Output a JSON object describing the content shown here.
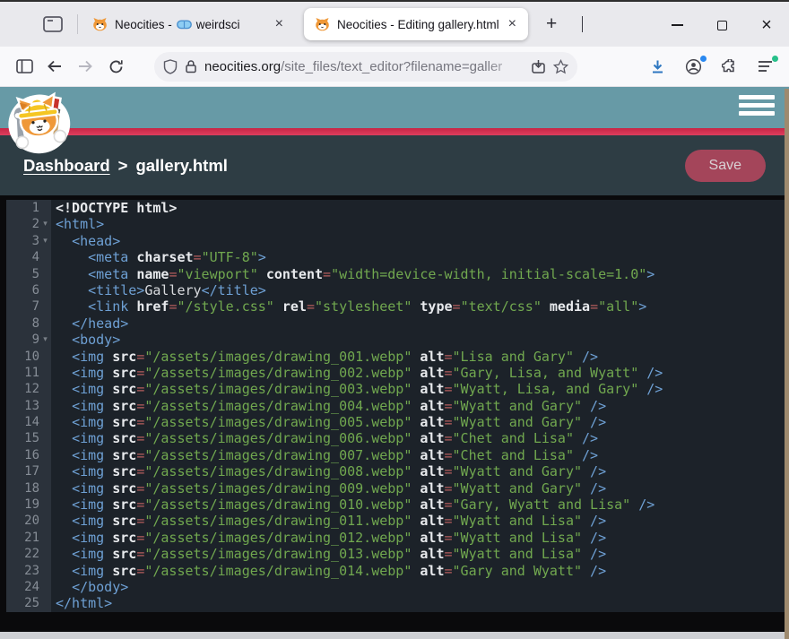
{
  "colors": {
    "header_teal": "#679aa6",
    "stripe_red": "#d22c4f",
    "content_bg": "#2e3d44",
    "save_button": "#a4455a",
    "editor_bg": "#1c2229",
    "gutter_bg": "#2b323b",
    "tag_blue": "#6ea0d4",
    "string_green": "#71a84f",
    "attr_white": "#e8eaed",
    "equals_red": "#b55d5d",
    "download_blue": "#2e77c0",
    "badge_blue": "#2a88f0",
    "badge_green": "#27c08a"
  },
  "tabs": {
    "tab1": {
      "title_prefix": "Neocities -",
      "title_suffix": "weirdsci",
      "close": "×"
    },
    "tab2": {
      "title": "Neocities - Editing gallery.html",
      "close": "×"
    },
    "new_tab": "+"
  },
  "window_controls": {
    "close": "×"
  },
  "toolbar": {
    "url_host": "neocities.org",
    "url_path": "/site_files/text_editor?filename=galler"
  },
  "breadcrumb": {
    "dashboard": "Dashboard",
    "separator": ">",
    "filename": "gallery.html"
  },
  "actions": {
    "save_label": "Save"
  },
  "editor": {
    "lines": [
      {
        "n": "1",
        "fold": false,
        "tokens": [
          [
            "d",
            "<!DOCTYPE html>"
          ]
        ]
      },
      {
        "n": "2",
        "fold": true,
        "tokens": [
          [
            "t",
            "<html>"
          ]
        ]
      },
      {
        "n": "3",
        "fold": true,
        "tokens": [
          [
            "p",
            "  "
          ],
          [
            "t",
            "<head>"
          ]
        ]
      },
      {
        "n": "4",
        "fold": false,
        "tokens": [
          [
            "p",
            "    "
          ],
          [
            "t",
            "<meta"
          ],
          [
            "p",
            " "
          ],
          [
            "a",
            "charset"
          ],
          [
            "e",
            "="
          ],
          [
            "s",
            "\"UTF-8\""
          ],
          [
            "t",
            ">"
          ]
        ]
      },
      {
        "n": "5",
        "fold": false,
        "tokens": [
          [
            "p",
            "    "
          ],
          [
            "t",
            "<meta"
          ],
          [
            "p",
            " "
          ],
          [
            "a",
            "name"
          ],
          [
            "e",
            "="
          ],
          [
            "s",
            "\"viewport\""
          ],
          [
            "p",
            " "
          ],
          [
            "a",
            "content"
          ],
          [
            "e",
            "="
          ],
          [
            "s",
            "\"width=device-width, initial-scale=1.0\""
          ],
          [
            "t",
            ">"
          ]
        ]
      },
      {
        "n": "6",
        "fold": false,
        "tokens": [
          [
            "p",
            "    "
          ],
          [
            "t",
            "<title>"
          ],
          [
            "p",
            "Gallery"
          ],
          [
            "t",
            "</title>"
          ]
        ]
      },
      {
        "n": "7",
        "fold": false,
        "tokens": [
          [
            "p",
            "    "
          ],
          [
            "t",
            "<link"
          ],
          [
            "p",
            " "
          ],
          [
            "a",
            "href"
          ],
          [
            "e",
            "="
          ],
          [
            "s",
            "\"/style.css\""
          ],
          [
            "p",
            " "
          ],
          [
            "a",
            "rel"
          ],
          [
            "e",
            "="
          ],
          [
            "s",
            "\"stylesheet\""
          ],
          [
            "p",
            " "
          ],
          [
            "a",
            "type"
          ],
          [
            "e",
            "="
          ],
          [
            "s",
            "\"text/css\""
          ],
          [
            "p",
            " "
          ],
          [
            "a",
            "media"
          ],
          [
            "e",
            "="
          ],
          [
            "s",
            "\"all\""
          ],
          [
            "t",
            ">"
          ]
        ]
      },
      {
        "n": "8",
        "fold": false,
        "tokens": [
          [
            "p",
            "  "
          ],
          [
            "t",
            "</head>"
          ]
        ]
      },
      {
        "n": "9",
        "fold": true,
        "tokens": [
          [
            "p",
            "  "
          ],
          [
            "t",
            "<body>"
          ]
        ]
      },
      {
        "n": "10",
        "fold": false,
        "tokens": [
          [
            "p",
            "  "
          ],
          [
            "t",
            "<img"
          ],
          [
            "p",
            " "
          ],
          [
            "a",
            "src"
          ],
          [
            "e",
            "="
          ],
          [
            "s",
            "\"/assets/images/drawing_001.webp\""
          ],
          [
            "p",
            " "
          ],
          [
            "a",
            "alt"
          ],
          [
            "e",
            "="
          ],
          [
            "s",
            "\"Lisa and Gary\""
          ],
          [
            "p",
            " "
          ],
          [
            "t",
            "/>"
          ]
        ]
      },
      {
        "n": "11",
        "fold": false,
        "tokens": [
          [
            "p",
            "  "
          ],
          [
            "t",
            "<img"
          ],
          [
            "p",
            " "
          ],
          [
            "a",
            "src"
          ],
          [
            "e",
            "="
          ],
          [
            "s",
            "\"/assets/images/drawing_002.webp\""
          ],
          [
            "p",
            " "
          ],
          [
            "a",
            "alt"
          ],
          [
            "e",
            "="
          ],
          [
            "s",
            "\"Gary, Lisa, and Wyatt\""
          ],
          [
            "p",
            " "
          ],
          [
            "t",
            "/>"
          ]
        ]
      },
      {
        "n": "12",
        "fold": false,
        "tokens": [
          [
            "p",
            "  "
          ],
          [
            "t",
            "<img"
          ],
          [
            "p",
            " "
          ],
          [
            "a",
            "src"
          ],
          [
            "e",
            "="
          ],
          [
            "s",
            "\"/assets/images/drawing_003.webp\""
          ],
          [
            "p",
            " "
          ],
          [
            "a",
            "alt"
          ],
          [
            "e",
            "="
          ],
          [
            "s",
            "\"Wyatt, Lisa, and Gary\""
          ],
          [
            "p",
            " "
          ],
          [
            "t",
            "/>"
          ]
        ]
      },
      {
        "n": "13",
        "fold": false,
        "tokens": [
          [
            "p",
            "  "
          ],
          [
            "t",
            "<img"
          ],
          [
            "p",
            " "
          ],
          [
            "a",
            "src"
          ],
          [
            "e",
            "="
          ],
          [
            "s",
            "\"/assets/images/drawing_004.webp\""
          ],
          [
            "p",
            " "
          ],
          [
            "a",
            "alt"
          ],
          [
            "e",
            "="
          ],
          [
            "s",
            "\"Wyatt and Gary\""
          ],
          [
            "p",
            " "
          ],
          [
            "t",
            "/>"
          ]
        ]
      },
      {
        "n": "14",
        "fold": false,
        "tokens": [
          [
            "p",
            "  "
          ],
          [
            "t",
            "<img"
          ],
          [
            "p",
            " "
          ],
          [
            "a",
            "src"
          ],
          [
            "e",
            "="
          ],
          [
            "s",
            "\"/assets/images/drawing_005.webp\""
          ],
          [
            "p",
            " "
          ],
          [
            "a",
            "alt"
          ],
          [
            "e",
            "="
          ],
          [
            "s",
            "\"Wyatt and Gary\""
          ],
          [
            "p",
            " "
          ],
          [
            "t",
            "/>"
          ]
        ]
      },
      {
        "n": "15",
        "fold": false,
        "tokens": [
          [
            "p",
            "  "
          ],
          [
            "t",
            "<img"
          ],
          [
            "p",
            " "
          ],
          [
            "a",
            "src"
          ],
          [
            "e",
            "="
          ],
          [
            "s",
            "\"/assets/images/drawing_006.webp\""
          ],
          [
            "p",
            " "
          ],
          [
            "a",
            "alt"
          ],
          [
            "e",
            "="
          ],
          [
            "s",
            "\"Chet and Lisa\""
          ],
          [
            "p",
            " "
          ],
          [
            "t",
            "/>"
          ]
        ]
      },
      {
        "n": "16",
        "fold": false,
        "tokens": [
          [
            "p",
            "  "
          ],
          [
            "t",
            "<img"
          ],
          [
            "p",
            " "
          ],
          [
            "a",
            "src"
          ],
          [
            "e",
            "="
          ],
          [
            "s",
            "\"/assets/images/drawing_007.webp\""
          ],
          [
            "p",
            " "
          ],
          [
            "a",
            "alt"
          ],
          [
            "e",
            "="
          ],
          [
            "s",
            "\"Chet and Lisa\""
          ],
          [
            "p",
            " "
          ],
          [
            "t",
            "/>"
          ]
        ]
      },
      {
        "n": "17",
        "fold": false,
        "tokens": [
          [
            "p",
            "  "
          ],
          [
            "t",
            "<img"
          ],
          [
            "p",
            " "
          ],
          [
            "a",
            "src"
          ],
          [
            "e",
            "="
          ],
          [
            "s",
            "\"/assets/images/drawing_008.webp\""
          ],
          [
            "p",
            " "
          ],
          [
            "a",
            "alt"
          ],
          [
            "e",
            "="
          ],
          [
            "s",
            "\"Wyatt and Gary\""
          ],
          [
            "p",
            " "
          ],
          [
            "t",
            "/>"
          ]
        ]
      },
      {
        "n": "18",
        "fold": false,
        "tokens": [
          [
            "p",
            "  "
          ],
          [
            "t",
            "<img"
          ],
          [
            "p",
            " "
          ],
          [
            "a",
            "src"
          ],
          [
            "e",
            "="
          ],
          [
            "s",
            "\"/assets/images/drawing_009.webp\""
          ],
          [
            "p",
            " "
          ],
          [
            "a",
            "alt"
          ],
          [
            "e",
            "="
          ],
          [
            "s",
            "\"Wyatt and Gary\""
          ],
          [
            "p",
            " "
          ],
          [
            "t",
            "/>"
          ]
        ]
      },
      {
        "n": "19",
        "fold": false,
        "tokens": [
          [
            "p",
            "  "
          ],
          [
            "t",
            "<img"
          ],
          [
            "p",
            " "
          ],
          [
            "a",
            "src"
          ],
          [
            "e",
            "="
          ],
          [
            "s",
            "\"/assets/images/drawing_010.webp\""
          ],
          [
            "p",
            " "
          ],
          [
            "a",
            "alt"
          ],
          [
            "e",
            "="
          ],
          [
            "s",
            "\"Gary, Wyatt and Lisa\""
          ],
          [
            "p",
            " "
          ],
          [
            "t",
            "/>"
          ]
        ]
      },
      {
        "n": "20",
        "fold": false,
        "tokens": [
          [
            "p",
            "  "
          ],
          [
            "t",
            "<img"
          ],
          [
            "p",
            " "
          ],
          [
            "a",
            "src"
          ],
          [
            "e",
            "="
          ],
          [
            "s",
            "\"/assets/images/drawing_011.webp\""
          ],
          [
            "p",
            " "
          ],
          [
            "a",
            "alt"
          ],
          [
            "e",
            "="
          ],
          [
            "s",
            "\"Wyatt and Lisa\""
          ],
          [
            "p",
            " "
          ],
          [
            "t",
            "/>"
          ]
        ]
      },
      {
        "n": "21",
        "fold": false,
        "tokens": [
          [
            "p",
            "  "
          ],
          [
            "t",
            "<img"
          ],
          [
            "p",
            " "
          ],
          [
            "a",
            "src"
          ],
          [
            "e",
            "="
          ],
          [
            "s",
            "\"/assets/images/drawing_012.webp\""
          ],
          [
            "p",
            " "
          ],
          [
            "a",
            "alt"
          ],
          [
            "e",
            "="
          ],
          [
            "s",
            "\"Wyatt and Lisa\""
          ],
          [
            "p",
            " "
          ],
          [
            "t",
            "/>"
          ]
        ]
      },
      {
        "n": "22",
        "fold": false,
        "tokens": [
          [
            "p",
            "  "
          ],
          [
            "t",
            "<img"
          ],
          [
            "p",
            " "
          ],
          [
            "a",
            "src"
          ],
          [
            "e",
            "="
          ],
          [
            "s",
            "\"/assets/images/drawing_013.webp\""
          ],
          [
            "p",
            " "
          ],
          [
            "a",
            "alt"
          ],
          [
            "e",
            "="
          ],
          [
            "s",
            "\"Wyatt and Lisa\""
          ],
          [
            "p",
            " "
          ],
          [
            "t",
            "/>"
          ]
        ]
      },
      {
        "n": "23",
        "fold": false,
        "tokens": [
          [
            "p",
            "  "
          ],
          [
            "t",
            "<img"
          ],
          [
            "p",
            " "
          ],
          [
            "a",
            "src"
          ],
          [
            "e",
            "="
          ],
          [
            "s",
            "\"/assets/images/drawing_014.webp\""
          ],
          [
            "p",
            " "
          ],
          [
            "a",
            "alt"
          ],
          [
            "e",
            "="
          ],
          [
            "s",
            "\"Gary and Wyatt\""
          ],
          [
            "p",
            " "
          ],
          [
            "t",
            "/>"
          ]
        ]
      },
      {
        "n": "24",
        "fold": false,
        "tokens": [
          [
            "p",
            "  "
          ],
          [
            "t",
            "</body>"
          ]
        ]
      },
      {
        "n": "25",
        "fold": false,
        "tokens": [
          [
            "t",
            "</html>"
          ]
        ]
      }
    ]
  }
}
